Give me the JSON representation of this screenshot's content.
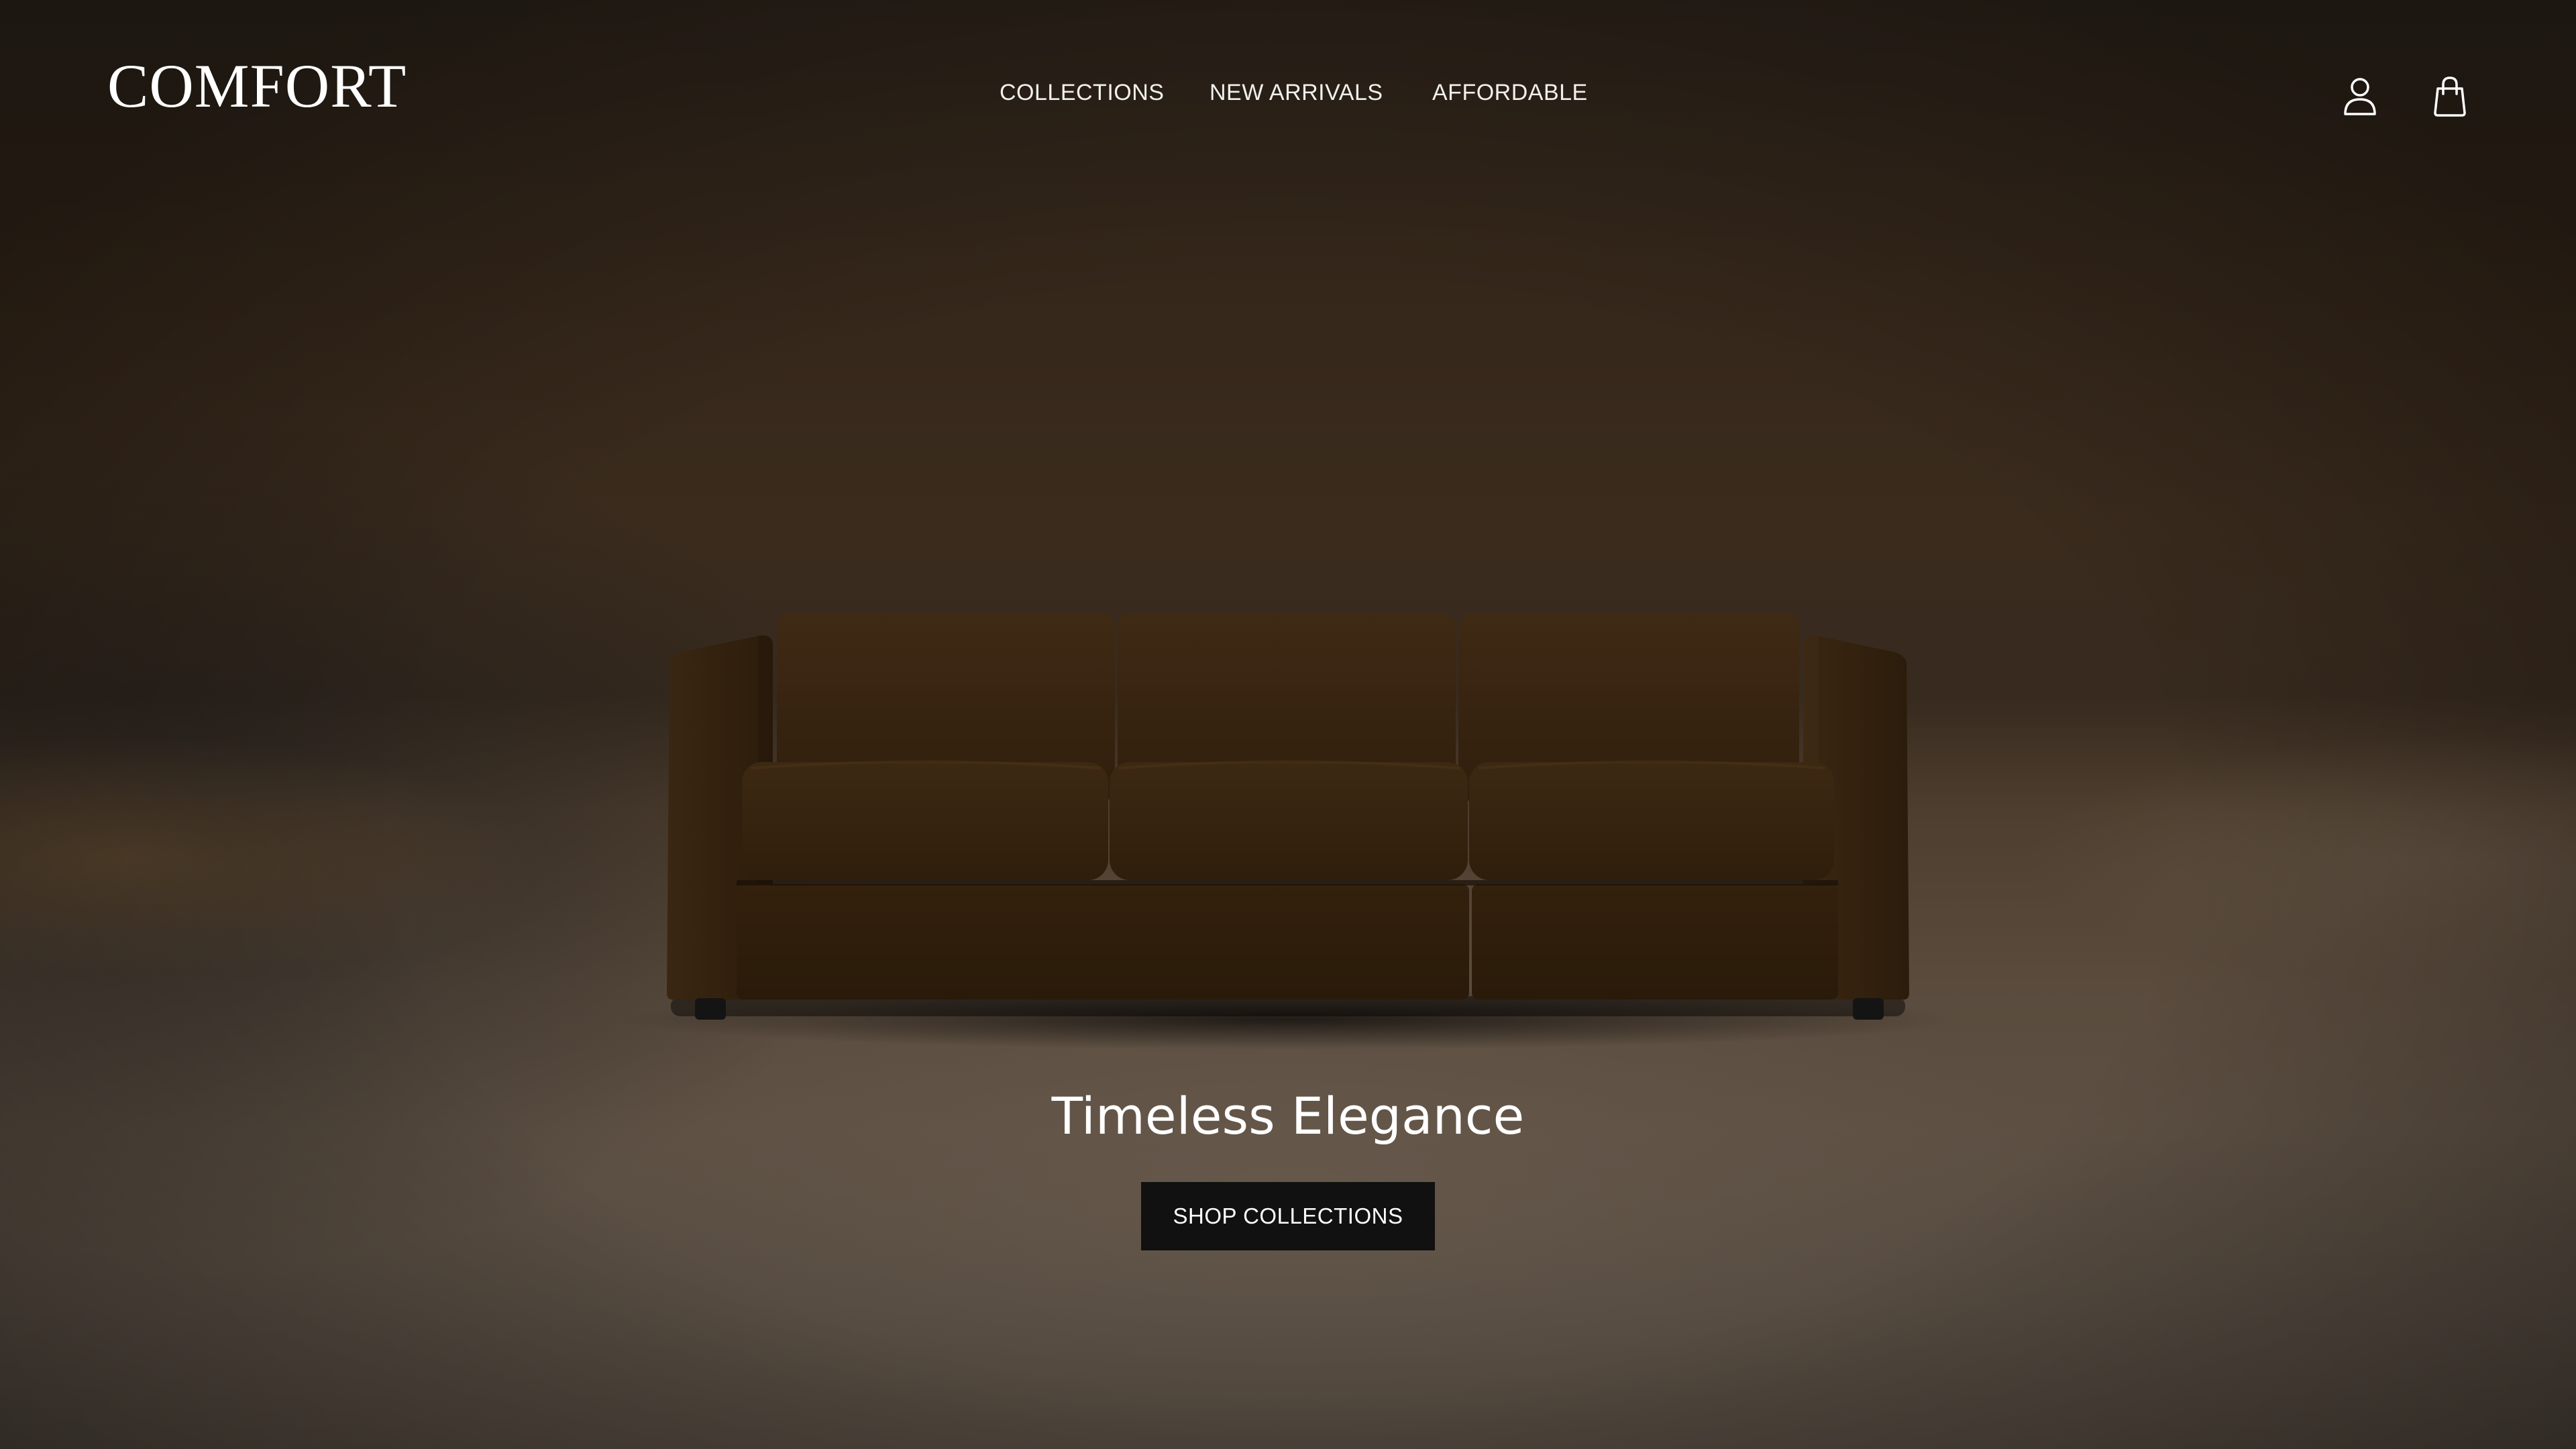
{
  "header": {
    "logo": "COMFORT",
    "nav": [
      {
        "label": "COLLECTIONS"
      },
      {
        "label": "NEW ARRIVALS"
      },
      {
        "label": "AFFORDABLE"
      }
    ],
    "icons": {
      "account": "user-icon",
      "cart": "shopping-bag-icon"
    }
  },
  "hero": {
    "image": "brown three-seat sofa",
    "title": "Timeless Elegance",
    "cta_label": "SHOP COLLECTIONS"
  },
  "colors": {
    "background": "#3a2b1d",
    "sofa": "#3a2510",
    "text": "#ffffff",
    "button": "#111111"
  }
}
